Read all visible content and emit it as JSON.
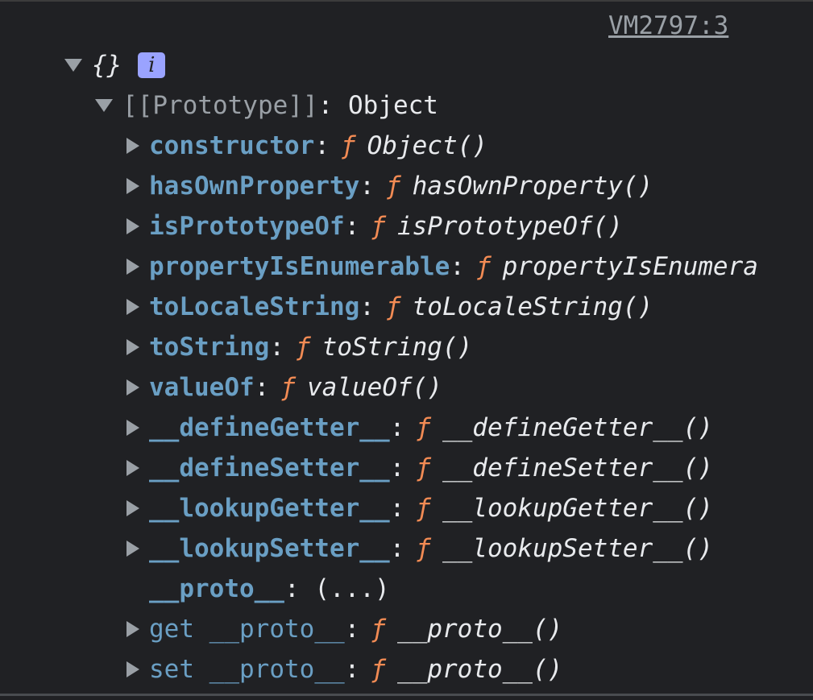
{
  "source": "VM2797:3",
  "root": {
    "label": "{}",
    "info": "i"
  },
  "prototype": {
    "key": "[[Prototype]]",
    "value": "Object"
  },
  "props": [
    {
      "key": "constructor",
      "fn": "Object()"
    },
    {
      "key": "hasOwnProperty",
      "fn": "hasOwnProperty()"
    },
    {
      "key": "isPrototypeOf",
      "fn": "isPrototypeOf()"
    },
    {
      "key": "propertyIsEnumerable",
      "fn": "propertyIsEnumerable()"
    },
    {
      "key": "toLocaleString",
      "fn": "toLocaleString()"
    },
    {
      "key": "toString",
      "fn": "toString()"
    },
    {
      "key": "valueOf",
      "fn": "valueOf()"
    },
    {
      "key": "__defineGetter__",
      "fn": "__defineGetter__()"
    },
    {
      "key": "__defineSetter__",
      "fn": "__defineSetter__()"
    },
    {
      "key": "__lookupGetter__",
      "fn": "__lookupGetter__()"
    },
    {
      "key": "__lookupSetter__",
      "fn": "__lookupSetter__()"
    }
  ],
  "proto_row": {
    "key": "__proto__",
    "value": "(...)"
  },
  "accessors": [
    {
      "prefix": "get",
      "key": "__proto__",
      "fn": "__proto__()"
    },
    {
      "prefix": "set",
      "key": "__proto__",
      "fn": "__proto__()"
    }
  ],
  "f_symbol": "ƒ",
  "colors": {
    "background": "#202124",
    "key": "#6a9fc4",
    "function": "#f28b54",
    "badge": "#9aa3ff"
  }
}
